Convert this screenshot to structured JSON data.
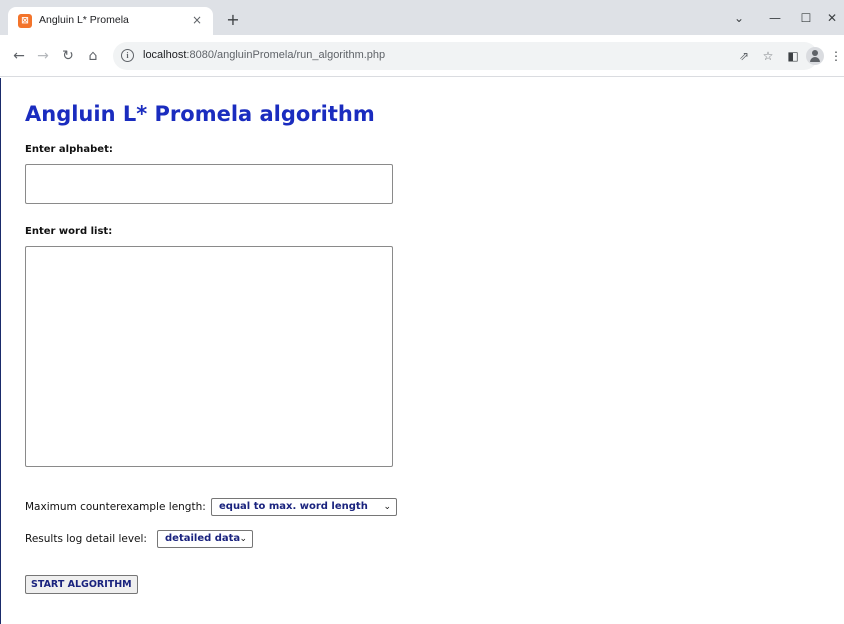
{
  "browser": {
    "tab_title": "Angluin L* Promela",
    "favicon_glyph": "⊠",
    "url_host": "localhost",
    "url_path": ":8080/angluinPromela/run_algorithm.php",
    "icons": {
      "close": "×",
      "new_tab": "+",
      "chevron": "⌄",
      "minimize": "—",
      "maximize": "☐",
      "window_close": "✕",
      "back": "←",
      "forward": "→",
      "reload": "↻",
      "home": "⌂",
      "info": "i",
      "share": "⇗",
      "star": "☆",
      "sidebar": "◧",
      "menu": "⋮"
    }
  },
  "page": {
    "title": "Angluin L* Promela algorithm",
    "alphabet_label": "Enter alphabet:",
    "alphabet_value": "",
    "wordlist_label": "Enter word list:",
    "wordlist_value": "",
    "max_ce_label": "Maximum counterexample length:",
    "max_ce_selected": "equal to max. word length",
    "log_level_label": "Results log detail level:",
    "log_level_selected": "detailed data",
    "chevron": "⌄",
    "start_button": "START ALGORITHM"
  },
  "colors": {
    "title": "#1a2cbf",
    "select_text": "#1a237e",
    "tabstrip": "#dee1e6",
    "favicon": "#f3742b"
  }
}
